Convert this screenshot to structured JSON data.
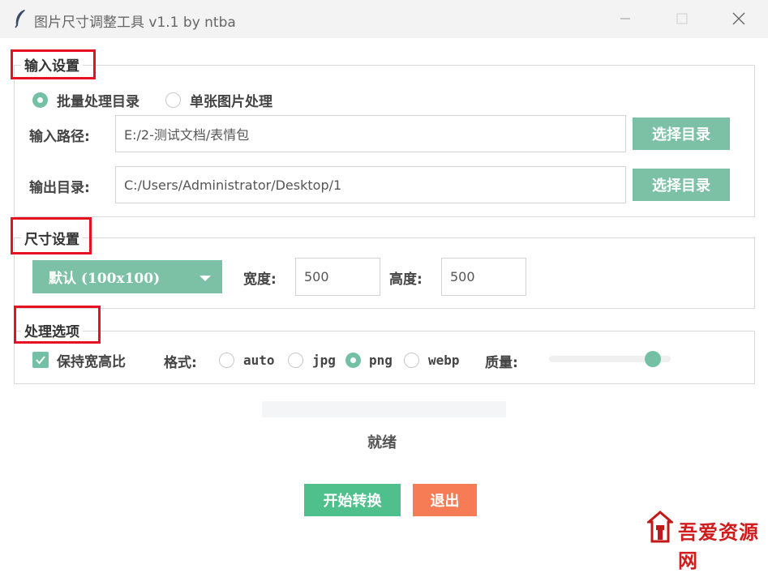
{
  "window": {
    "title": "图片尺寸调整工具 v1.1 by ntba"
  },
  "input_group": {
    "label": "输入设置",
    "mode_batch": "批量处理目录",
    "mode_single": "单张图片处理",
    "selected_mode": "batch",
    "input_path_label": "输入路径:",
    "input_path_value": "E:/2-测试文档/表情包",
    "input_choose": "选择目录",
    "output_dir_label": "输出目录:",
    "output_dir_value": "C:/Users/Administrator/Desktop/1",
    "output_choose": "选择目录"
  },
  "size_group": {
    "label": "尺寸设置",
    "preset": "默认 (100x100)",
    "width_label": "宽度:",
    "width_value": "500",
    "height_label": "高度:",
    "height_value": "500"
  },
  "options_group": {
    "label": "处理选项",
    "keep_ratio_label": "保持宽高比",
    "keep_ratio_checked": true,
    "format_label": "格式:",
    "formats": [
      "auto",
      "jpg",
      "png",
      "webp"
    ],
    "selected_format": "png",
    "quality_label": "质量:",
    "quality_fraction": 0.85
  },
  "status": {
    "progress_fraction": 0,
    "text": "就绪"
  },
  "actions": {
    "start": "开始转换",
    "exit": "退出"
  },
  "watermark": {
    "text": "吾爱资源网"
  },
  "colors": {
    "accent": "#73c0a5",
    "start": "#4fbf8b",
    "exit": "#f57c55",
    "highlight": "#e81123"
  }
}
